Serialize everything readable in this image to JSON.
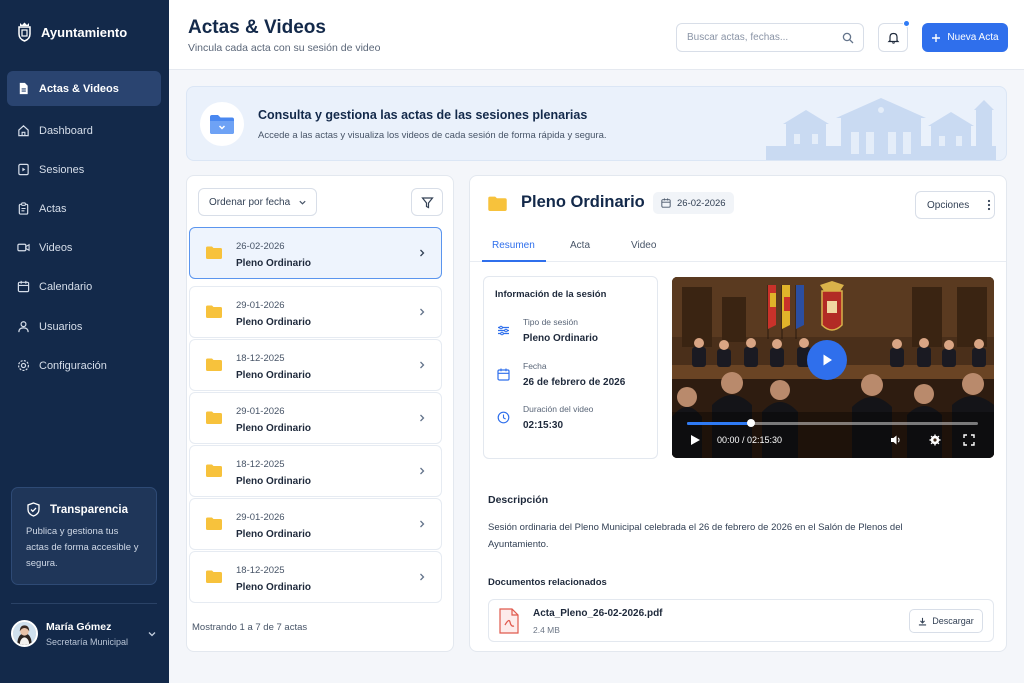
{
  "sidebar": {
    "brand": "Ayuntamiento",
    "items": [
      {
        "label": "Actas & Videos",
        "icon": "document-icon",
        "active": true
      },
      {
        "label": "Dashboard",
        "icon": "home-icon"
      },
      {
        "label": "Sesiones",
        "icon": "play-file-icon"
      },
      {
        "label": "Actas",
        "icon": "clipboard-icon"
      },
      {
        "label": "Videos",
        "icon": "video-icon"
      },
      {
        "label": "Calendario",
        "icon": "calendar-icon"
      },
      {
        "label": "Usuarios",
        "icon": "users-icon"
      },
      {
        "label": "Configuración",
        "icon": "gear-icon"
      }
    ],
    "transparency": {
      "title": "Transparencia",
      "text": "Publica y gestiona tus actas de forma accesible y segura."
    },
    "user": {
      "name": "María Gómez",
      "role": "Secretaría Municipal"
    }
  },
  "header": {
    "title": "Actas & Videos",
    "subtitle": "Vincula cada acta con su sesión de video",
    "search_placeholder": "Buscar actas, fechas...",
    "new_button": "Nueva Acta"
  },
  "banner": {
    "title": "Consulta y gestiona las actas de las sesiones plenarias",
    "text": "Accede a las actas y visualiza los videos de cada sesión de forma rápida y segura."
  },
  "list": {
    "sort_label": "Ordenar por fecha",
    "items": [
      {
        "date": "26-02-2026",
        "name": "Pleno Ordinario",
        "selected": true
      },
      {
        "date": "29-01-2026",
        "name": "Pleno Ordinario"
      },
      {
        "date": "18-12-2025",
        "name": "Pleno Ordinario"
      },
      {
        "date": "29-01-2026",
        "name": "Pleno Ordinario"
      },
      {
        "date": "18-12-2025",
        "name": "Pleno Ordinario"
      },
      {
        "date": "29-01-2026",
        "name": "Pleno Ordinario"
      },
      {
        "date": "18-12-2025",
        "name": "Pleno Ordinario"
      }
    ],
    "footer": "Mostrando 1 a 7 de 7 actas"
  },
  "detail": {
    "title": "Pleno Ordinario",
    "date": "26-02-2026",
    "options_label": "Opciones",
    "tabs": [
      "Resumen",
      "Acta",
      "Video"
    ],
    "active_tab": "Resumen",
    "info": {
      "title": "Información de la sesión",
      "rows": [
        {
          "label": "Tipo de sesión",
          "value": "Pleno Ordinario"
        },
        {
          "label": "Fecha",
          "value": "26 de febrero de 2026"
        },
        {
          "label": "Duración del video",
          "value": "02:15:30"
        }
      ]
    },
    "video": {
      "time": "00:00 / 02:15:30",
      "progress": 0.22
    },
    "description": {
      "title": "Descripción",
      "text": "Sesión ordinaria del Pleno Municipal celebrada el 26 de febrero de 2026 en el Salón de Plenos del Ayuntamiento."
    },
    "documents": {
      "title": "Documentos relacionados",
      "file_name": "Acta_Pleno_26-02-2026.pdf",
      "file_size": "2.4 MB",
      "download_label": "Descargar"
    }
  },
  "colors": {
    "sidebar": "#13294a",
    "accent": "#2f6fec",
    "folder": "#f7c23c"
  }
}
